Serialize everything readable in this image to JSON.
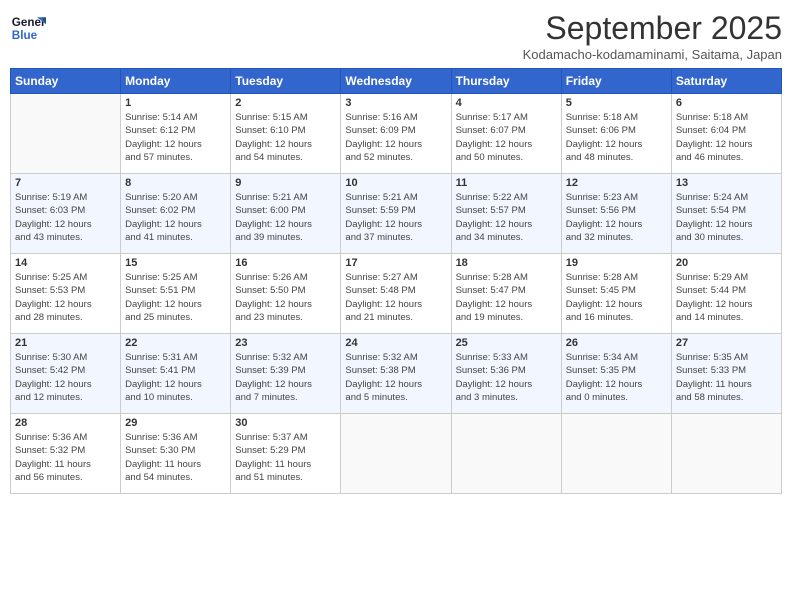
{
  "header": {
    "logo_line1": "General",
    "logo_line2": "Blue",
    "month": "September 2025",
    "location": "Kodamacho-kodamaminami, Saitama, Japan"
  },
  "weekdays": [
    "Sunday",
    "Monday",
    "Tuesday",
    "Wednesday",
    "Thursday",
    "Friday",
    "Saturday"
  ],
  "weeks": [
    [
      {
        "day": "",
        "detail": ""
      },
      {
        "day": "1",
        "detail": "Sunrise: 5:14 AM\nSunset: 6:12 PM\nDaylight: 12 hours\nand 57 minutes."
      },
      {
        "day": "2",
        "detail": "Sunrise: 5:15 AM\nSunset: 6:10 PM\nDaylight: 12 hours\nand 54 minutes."
      },
      {
        "day": "3",
        "detail": "Sunrise: 5:16 AM\nSunset: 6:09 PM\nDaylight: 12 hours\nand 52 minutes."
      },
      {
        "day": "4",
        "detail": "Sunrise: 5:17 AM\nSunset: 6:07 PM\nDaylight: 12 hours\nand 50 minutes."
      },
      {
        "day": "5",
        "detail": "Sunrise: 5:18 AM\nSunset: 6:06 PM\nDaylight: 12 hours\nand 48 minutes."
      },
      {
        "day": "6",
        "detail": "Sunrise: 5:18 AM\nSunset: 6:04 PM\nDaylight: 12 hours\nand 46 minutes."
      }
    ],
    [
      {
        "day": "7",
        "detail": "Sunrise: 5:19 AM\nSunset: 6:03 PM\nDaylight: 12 hours\nand 43 minutes."
      },
      {
        "day": "8",
        "detail": "Sunrise: 5:20 AM\nSunset: 6:02 PM\nDaylight: 12 hours\nand 41 minutes."
      },
      {
        "day": "9",
        "detail": "Sunrise: 5:21 AM\nSunset: 6:00 PM\nDaylight: 12 hours\nand 39 minutes."
      },
      {
        "day": "10",
        "detail": "Sunrise: 5:21 AM\nSunset: 5:59 PM\nDaylight: 12 hours\nand 37 minutes."
      },
      {
        "day": "11",
        "detail": "Sunrise: 5:22 AM\nSunset: 5:57 PM\nDaylight: 12 hours\nand 34 minutes."
      },
      {
        "day": "12",
        "detail": "Sunrise: 5:23 AM\nSunset: 5:56 PM\nDaylight: 12 hours\nand 32 minutes."
      },
      {
        "day": "13",
        "detail": "Sunrise: 5:24 AM\nSunset: 5:54 PM\nDaylight: 12 hours\nand 30 minutes."
      }
    ],
    [
      {
        "day": "14",
        "detail": "Sunrise: 5:25 AM\nSunset: 5:53 PM\nDaylight: 12 hours\nand 28 minutes."
      },
      {
        "day": "15",
        "detail": "Sunrise: 5:25 AM\nSunset: 5:51 PM\nDaylight: 12 hours\nand 25 minutes."
      },
      {
        "day": "16",
        "detail": "Sunrise: 5:26 AM\nSunset: 5:50 PM\nDaylight: 12 hours\nand 23 minutes."
      },
      {
        "day": "17",
        "detail": "Sunrise: 5:27 AM\nSunset: 5:48 PM\nDaylight: 12 hours\nand 21 minutes."
      },
      {
        "day": "18",
        "detail": "Sunrise: 5:28 AM\nSunset: 5:47 PM\nDaylight: 12 hours\nand 19 minutes."
      },
      {
        "day": "19",
        "detail": "Sunrise: 5:28 AM\nSunset: 5:45 PM\nDaylight: 12 hours\nand 16 minutes."
      },
      {
        "day": "20",
        "detail": "Sunrise: 5:29 AM\nSunset: 5:44 PM\nDaylight: 12 hours\nand 14 minutes."
      }
    ],
    [
      {
        "day": "21",
        "detail": "Sunrise: 5:30 AM\nSunset: 5:42 PM\nDaylight: 12 hours\nand 12 minutes."
      },
      {
        "day": "22",
        "detail": "Sunrise: 5:31 AM\nSunset: 5:41 PM\nDaylight: 12 hours\nand 10 minutes."
      },
      {
        "day": "23",
        "detail": "Sunrise: 5:32 AM\nSunset: 5:39 PM\nDaylight: 12 hours\nand 7 minutes."
      },
      {
        "day": "24",
        "detail": "Sunrise: 5:32 AM\nSunset: 5:38 PM\nDaylight: 12 hours\nand 5 minutes."
      },
      {
        "day": "25",
        "detail": "Sunrise: 5:33 AM\nSunset: 5:36 PM\nDaylight: 12 hours\nand 3 minutes."
      },
      {
        "day": "26",
        "detail": "Sunrise: 5:34 AM\nSunset: 5:35 PM\nDaylight: 12 hours\nand 0 minutes."
      },
      {
        "day": "27",
        "detail": "Sunrise: 5:35 AM\nSunset: 5:33 PM\nDaylight: 11 hours\nand 58 minutes."
      }
    ],
    [
      {
        "day": "28",
        "detail": "Sunrise: 5:36 AM\nSunset: 5:32 PM\nDaylight: 11 hours\nand 56 minutes."
      },
      {
        "day": "29",
        "detail": "Sunrise: 5:36 AM\nSunset: 5:30 PM\nDaylight: 11 hours\nand 54 minutes."
      },
      {
        "day": "30",
        "detail": "Sunrise: 5:37 AM\nSunset: 5:29 PM\nDaylight: 11 hours\nand 51 minutes."
      },
      {
        "day": "",
        "detail": ""
      },
      {
        "day": "",
        "detail": ""
      },
      {
        "day": "",
        "detail": ""
      },
      {
        "day": "",
        "detail": ""
      }
    ]
  ]
}
